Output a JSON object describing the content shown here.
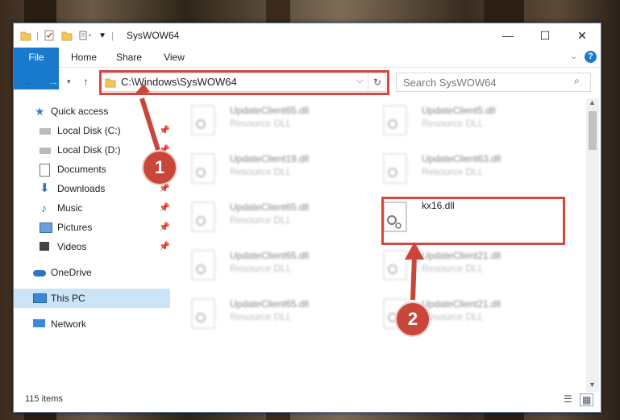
{
  "window": {
    "title": "SysWOW64",
    "minimize": "—",
    "maximize": "☐",
    "close": "✕"
  },
  "ribbon": {
    "tabs": [
      "File",
      "Home",
      "Share",
      "View"
    ],
    "expand_icon": "chevron-down-icon",
    "help_icon": "help-icon"
  },
  "address": {
    "path": "C:\\Windows\\SysWOW64",
    "search_placeholder": "Search SysWOW64"
  },
  "sidebar": {
    "items": [
      {
        "label": "Quick access",
        "icon": "star-icon",
        "pinned": false
      },
      {
        "label": "Local Disk (C:)",
        "icon": "drive-icon",
        "pinned": true
      },
      {
        "label": "Local Disk (D:)",
        "icon": "drive-icon",
        "pinned": true
      },
      {
        "label": "Documents",
        "icon": "documents-icon",
        "pinned": true
      },
      {
        "label": "Downloads",
        "icon": "download-icon",
        "pinned": true
      },
      {
        "label": "Music",
        "icon": "music-icon",
        "pinned": true
      },
      {
        "label": "Pictures",
        "icon": "pictures-icon",
        "pinned": true
      },
      {
        "label": "Videos",
        "icon": "videos-icon",
        "pinned": true
      },
      {
        "label": "OneDrive",
        "icon": "cloud-icon",
        "pinned": false
      },
      {
        "label": "This PC",
        "icon": "computer-icon",
        "pinned": false,
        "selected": true
      },
      {
        "label": "Network",
        "icon": "network-icon",
        "pinned": false
      }
    ]
  },
  "files": {
    "left": [
      {
        "name": "UpdateClient65.dll",
        "type": "Resource DLL"
      },
      {
        "name": "UpdateClient19.dll",
        "type": "Resource DLL"
      },
      {
        "name": "UpdateClient65.dll",
        "type": "Resource DLL"
      },
      {
        "name": "UpdateClient65.dll",
        "type": "Resource DLL"
      },
      {
        "name": "UpdateClient65.dll",
        "type": "Resource DLL"
      }
    ],
    "right": [
      {
        "name": "UpdateClient5.dll",
        "type": "Resource DLL"
      },
      {
        "name": "UpdateClient63.dll",
        "type": "Resource DLL"
      },
      {
        "name": "kx16.dll",
        "type": "",
        "highlighted": true
      },
      {
        "name": "UpdateClient21.dll",
        "type": "Resource DLL"
      },
      {
        "name": "UpdateClient21.dll",
        "type": "Resource DLL"
      }
    ]
  },
  "callouts": [
    "1",
    "2"
  ],
  "status": {
    "item_count": "115 items"
  },
  "colors": {
    "accent": "#1979ca",
    "highlight_red": "#d9453f",
    "callout": "#c9463a"
  }
}
